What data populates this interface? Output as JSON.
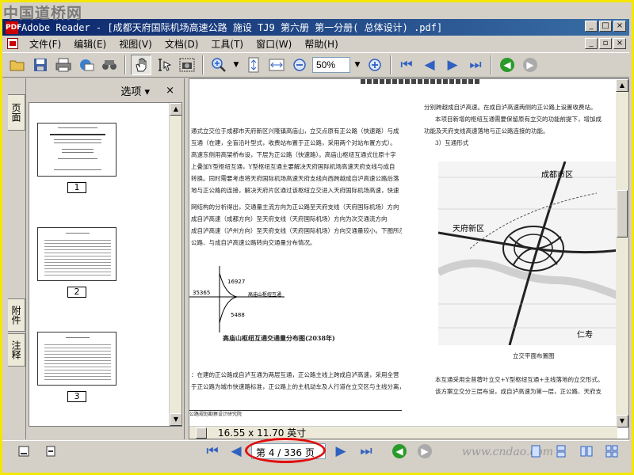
{
  "watermark": "中国道桥网",
  "window": {
    "app_icon": "PDF",
    "title": "Adobe Reader - [成都天府国际机场高速公路 施设 TJ9 第六册 第一分册( 总体设计) .pdf]",
    "buttons": [
      "_",
      "□",
      "×"
    ]
  },
  "menu": {
    "items": [
      "文件(F)",
      "编辑(E)",
      "视图(V)",
      "文档(D)",
      "工具(T)",
      "窗口(W)",
      "帮助(H)"
    ],
    "mdi_buttons": [
      "_",
      "▫",
      "×"
    ]
  },
  "toolbar": {
    "zoom_value": "50%",
    "icons": [
      "open-icon",
      "save-icon",
      "print-icon",
      "email-icon",
      "search-binoculars-icon",
      "hand-tool-icon",
      "select-text-icon",
      "snapshot-icon",
      "zoom-in-tool-icon",
      "fit-page-icon",
      "fit-width-icon",
      "zoom-out-icon",
      "zoom-plus-icon",
      "first-page-icon",
      "prev-page-icon",
      "next-page-icon",
      "last-page-icon",
      "back-icon",
      "forward-icon"
    ]
  },
  "left_tabs": [
    "页面",
    "附件",
    "注释"
  ],
  "thumbnails": {
    "options_label": "选项",
    "close_label": "×",
    "pages": [
      {
        "label": "1"
      },
      {
        "label": "2"
      },
      {
        "label": "3"
      }
    ]
  },
  "document": {
    "left_lines": [
      "通式立交位于成都市天府新区兴隆镇高庙山，立交点原有正公路（快速路）与成",
      "互通（在建，全盲沿叶型式，收费站布置于正公路，采用两个对站布置方式）。",
      "高速东侧用高架桥布设，下层为正公路（快速路）。高庙山枢纽互通式位原十字",
      "上叠加Y型枢纽互通，Y型枢纽互通主要解决天府国际机场高速天府支线与成自",
      "转换。同时需要考虑将天府国际机场高速天府支线向西跨越成自泸高速公路后落",
      "地与正公路的连接，解决天府片区通过该枢纽立交进入天府国际机场高速，快速",
      "",
      "网结构的分析得出，交通量主流方向为正公路至天府支线（天府国际机场）方向",
      "成自泸高速（成都方向）至天府支线（天府国际机场）方向为次交通流方向",
      "成自泸高速（泸州方向）至天府支线（天府国际机场）方向交通量较小。下图所示",
      "公路、与成自泸高速公路转向交通量分布情况。"
    ],
    "diagram": {
      "v1": "16927",
      "v2": "35365",
      "v3": "5488",
      "road": "高庙山枢纽互通",
      "caption": "高庙山枢纽互通交通量分布图(2038年)"
    },
    "left_bottom_lines": [
      "：在建的正公路成自泸互通为两层互通，正公路主线上跨成自泸高速，采用全营",
      "于正公路为城市快速路标准，正公路上的主机动车及人行道在立交区与主线分离，"
    ],
    "left_footer": "公路规划勘察设计研究院",
    "right_lines": [
      "分别跨越成自泸高速。在成自泸高速两侧的正公路上设置收费站。",
      "本项目新增的枢纽互通需要保留原有立交的功能前提下，增加成",
      "功能及天府支线高速落地与正公路连接的功能。",
      "3）互通形式"
    ],
    "map_labels": {
      "chengdu": "成都市区",
      "tianfu": "天府新区",
      "renshou": "仁寿"
    },
    "map_caption": "立交平面布置图",
    "right_bottom_lines": [
      "本互通采用全苜蓿叶立交+Y型枢纽互通+主线落地的立交形式。",
      "该方案立交分三层布设，成自泸高速为第一层，正公路、天府支"
    ],
    "page_size": "16.55 x 11.70 英寸"
  },
  "status": {
    "page_indicator": "第 4 / 336 页",
    "url_watermark": "www.cndao.com"
  }
}
